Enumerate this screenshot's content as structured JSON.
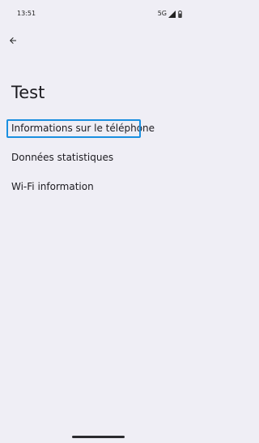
{
  "status_bar": {
    "time": "13:51",
    "network": "5G",
    "signal_icon": "signal-icon",
    "battery_icon": "battery-icon"
  },
  "toolbar": {
    "back_icon": "arrow-left-icon"
  },
  "page": {
    "title": "Test"
  },
  "menu": {
    "items": [
      {
        "label": "Informations sur le téléphone",
        "focused": true
      },
      {
        "label": "Données statistiques",
        "focused": false
      },
      {
        "label": "Wi-Fi information",
        "focused": false
      }
    ]
  },
  "colors": {
    "background": "#efeef5",
    "focus": "#1a8fe0",
    "text": "#1c1b20"
  }
}
